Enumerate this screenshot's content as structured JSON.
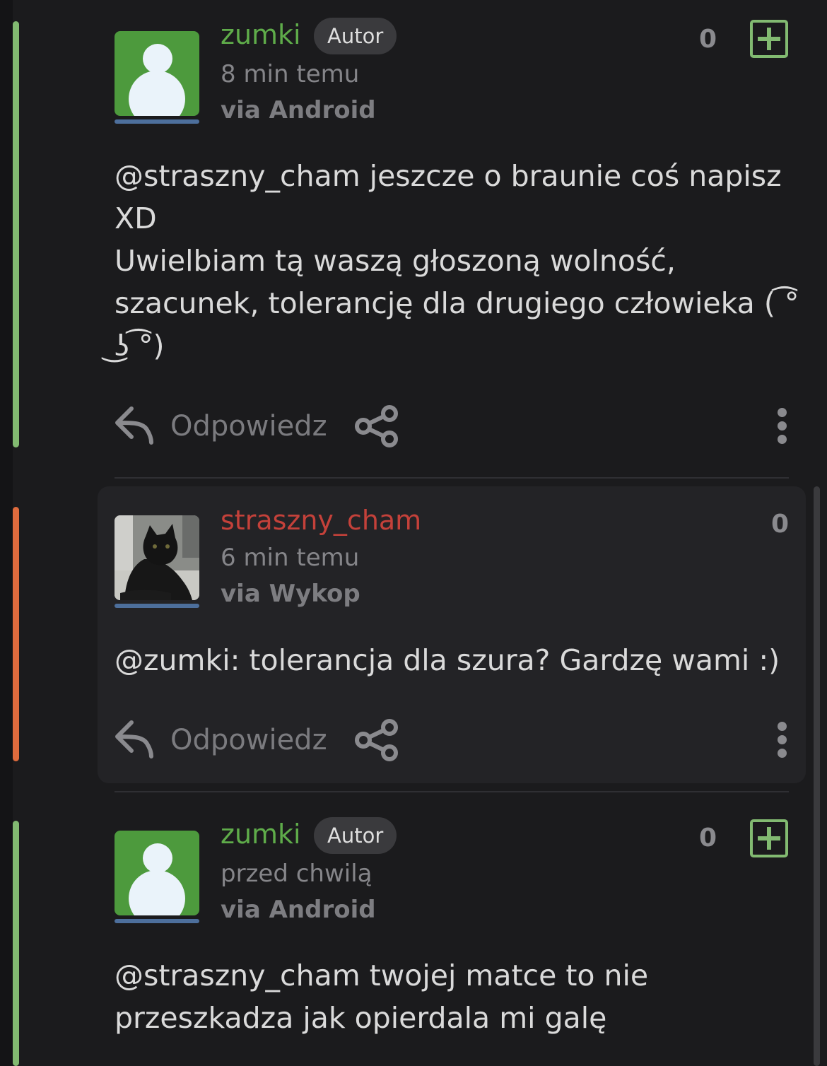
{
  "comments": [
    {
      "username": "zumki",
      "badge": "Autor",
      "time": "8 min temu",
      "via": "via Android",
      "score": "0",
      "body_lines": [
        "@straszny_cham jeszcze o braunie coś napisz",
        "XD",
        "Uwielbiam tą waszą głoszoną wolność,",
        "szacunek, tolerancję dla drugiego człowieka ( ͡°",
        " ͜ʖ ͡°)"
      ],
      "reply_label": "Odpowiedz"
    },
    {
      "username": "straszny_cham",
      "time": "6 min temu",
      "via": "via Wykop",
      "score": "0",
      "body_lines": [
        "@zumki: tolerancja dla szura? Gardzę wami :)"
      ],
      "reply_label": "Odpowiedz"
    },
    {
      "username": "zumki",
      "badge": "Autor",
      "time": "przed chwilą",
      "via": "via Android",
      "score": "0",
      "body_lines": [
        "@straszny_cham twojej matce to nie",
        "przeszkadza jak opierdala mi galę"
      ]
    }
  ],
  "colors": {
    "background": "#1b1b1d",
    "author_green": "#5fac4a",
    "user_red": "#c4413a",
    "thread_green": "#82ba71",
    "thread_orange": "#df6b3d"
  },
  "icons": [
    "reply-arrow-icon",
    "share-icon",
    "more-vertical-icon",
    "plus-square-icon",
    "default-avatar-icon"
  ]
}
